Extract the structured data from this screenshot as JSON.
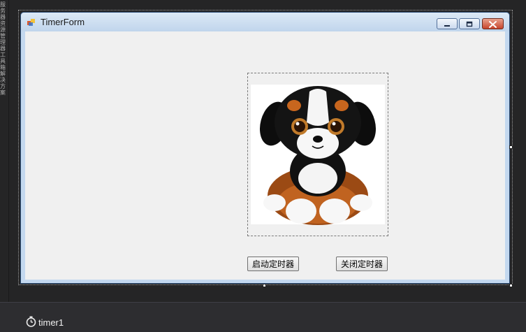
{
  "window": {
    "title": "TimerForm"
  },
  "controls": {
    "start_timer_label": "启动定时器",
    "stop_timer_label": "关闭定时器"
  },
  "component_tray": {
    "items": [
      {
        "name": "timer1",
        "icon": "stopwatch-icon"
      }
    ]
  },
  "left_rail": {
    "text": "服务器资源管理器 工具箱 解决方案"
  },
  "colors": {
    "ide_background": "#2d2d30",
    "form_client": "#f0f0f0",
    "titlebar_top": "#dce9f6",
    "titlebar_bottom": "#c0d5ec",
    "close_button": "#c7442b",
    "tray_text": "#f1f1f1"
  }
}
